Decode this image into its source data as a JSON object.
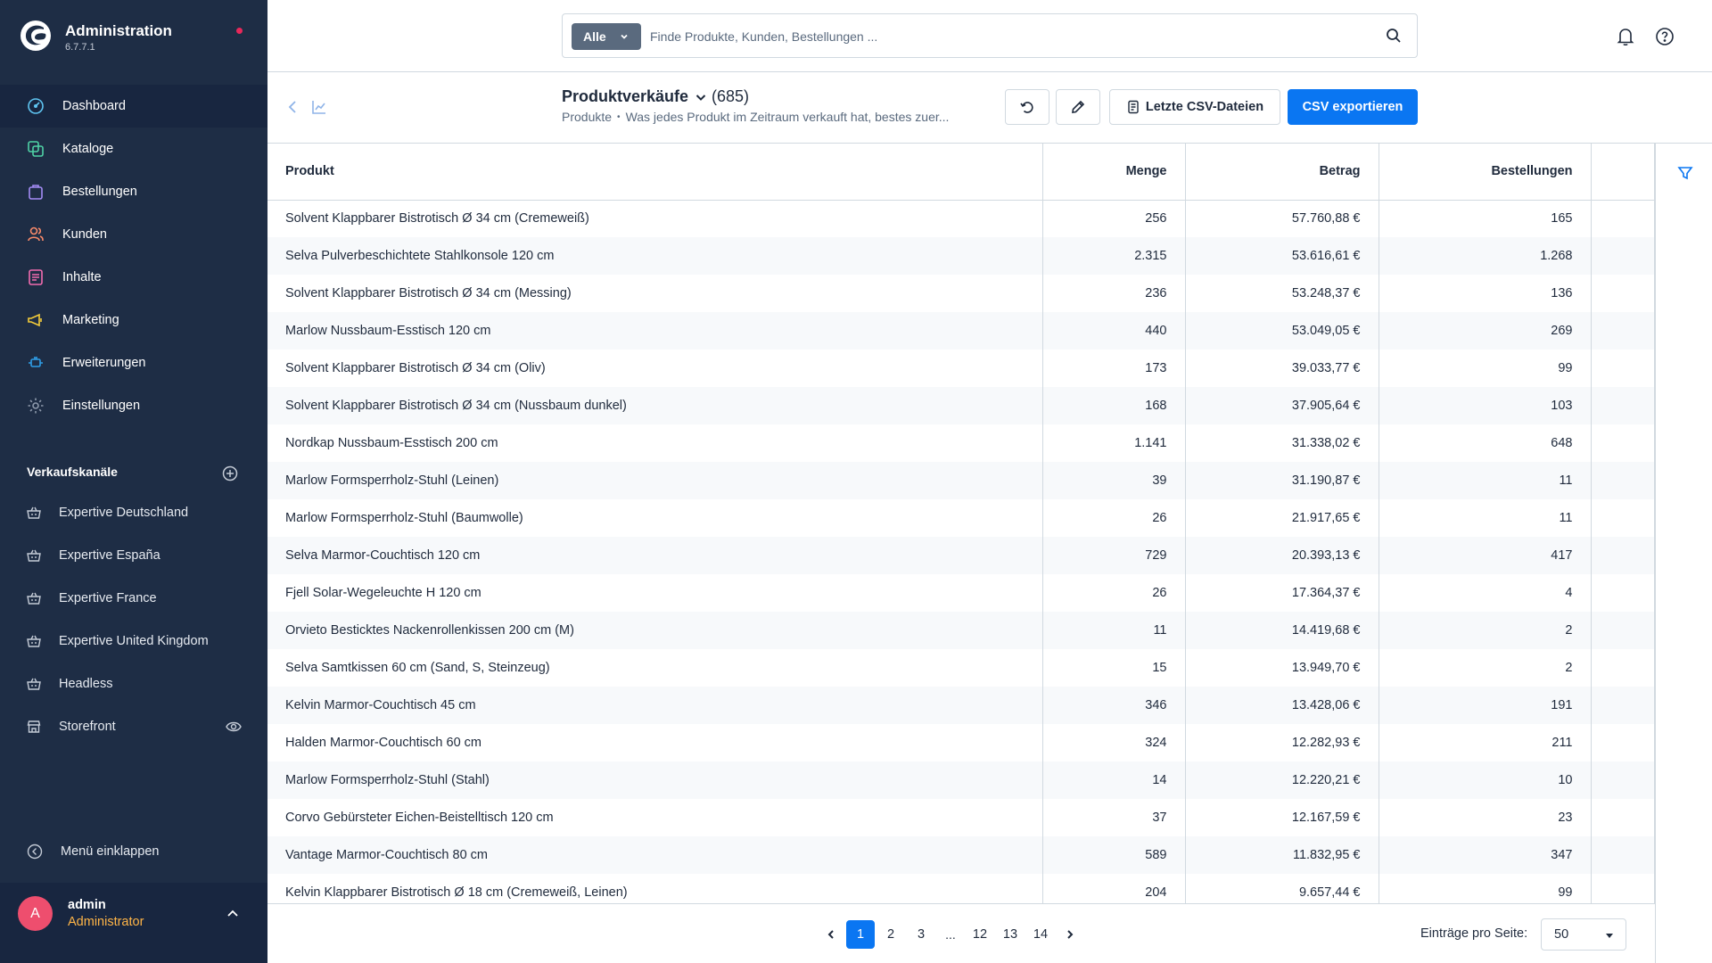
{
  "app": {
    "title": "Administration",
    "version": "6.7.7.1"
  },
  "nav": [
    {
      "label": "Dashboard",
      "icon": "dashboard-icon",
      "active": true
    },
    {
      "label": "Kataloge",
      "icon": "catalog-icon"
    },
    {
      "label": "Bestellungen",
      "icon": "orders-icon"
    },
    {
      "label": "Kunden",
      "icon": "customers-icon"
    },
    {
      "label": "Inhalte",
      "icon": "content-icon"
    },
    {
      "label": "Marketing",
      "icon": "marketing-icon"
    },
    {
      "label": "Erweiterungen",
      "icon": "extensions-icon"
    },
    {
      "label": "Einstellungen",
      "icon": "settings-icon"
    }
  ],
  "sales_channels": {
    "title": "Verkaufskanäle",
    "items": [
      {
        "label": "Expertive Deutschland"
      },
      {
        "label": "Expertive España"
      },
      {
        "label": "Expertive France"
      },
      {
        "label": "Expertive United Kingdom"
      },
      {
        "label": "Headless"
      },
      {
        "label": "Storefront"
      }
    ]
  },
  "collapse_label": "Menü einklappen",
  "user": {
    "initial": "A",
    "name": "admin",
    "role": "Administrator"
  },
  "search": {
    "type": "Alle",
    "placeholder": "Finde Produkte, Kunden, Bestellungen ..."
  },
  "smartbar": {
    "title": "Produktverkäufe",
    "count": "(685)",
    "breadcrumb_root": "Produkte",
    "breadcrumb_desc": "Was jedes Produkt im Zeitraum verkauft hat, bestes zuer...",
    "csv_files_label": "Letzte CSV-Dateien",
    "export_label": "CSV exportieren"
  },
  "colors": {
    "accent": "#0a76f2",
    "sidebar": "#1e2d45",
    "status_dot": "#e8285a",
    "role": "#ffb547"
  },
  "table": {
    "headers": {
      "product": "Produkt",
      "quantity": "Menge",
      "amount": "Betrag",
      "orders": "Bestellungen"
    },
    "rows": [
      {
        "product": "Solvent Klappbarer Bistrotisch Ø 34 cm (Cremeweiß)",
        "quantity": "256",
        "amount": "57.760,88 €",
        "orders": "165"
      },
      {
        "product": "Selva Pulverbeschichtete Stahlkonsole 120 cm",
        "quantity": "2.315",
        "amount": "53.616,61 €",
        "orders": "1.268"
      },
      {
        "product": "Solvent Klappbarer Bistrotisch Ø 34 cm (Messing)",
        "quantity": "236",
        "amount": "53.248,37 €",
        "orders": "136"
      },
      {
        "product": "Marlow Nussbaum-Esstisch 120 cm",
        "quantity": "440",
        "amount": "53.049,05 €",
        "orders": "269"
      },
      {
        "product": "Solvent Klappbarer Bistrotisch Ø 34 cm (Oliv)",
        "quantity": "173",
        "amount": "39.033,77 €",
        "orders": "99"
      },
      {
        "product": "Solvent Klappbarer Bistrotisch Ø 34 cm (Nussbaum dunkel)",
        "quantity": "168",
        "amount": "37.905,64 €",
        "orders": "103"
      },
      {
        "product": "Nordkap Nussbaum-Esstisch 200 cm",
        "quantity": "1.141",
        "amount": "31.338,02 €",
        "orders": "648"
      },
      {
        "product": "Marlow Formsperrholz-Stuhl (Leinen)",
        "quantity": "39",
        "amount": "31.190,87 €",
        "orders": "11"
      },
      {
        "product": "Marlow Formsperrholz-Stuhl (Baumwolle)",
        "quantity": "26",
        "amount": "21.917,65 €",
        "orders": "11"
      },
      {
        "product": "Selva Marmor-Couchtisch 120 cm",
        "quantity": "729",
        "amount": "20.393,13 €",
        "orders": "417"
      },
      {
        "product": "Fjell Solar-Wegeleuchte H 120 cm",
        "quantity": "26",
        "amount": "17.364,37 €",
        "orders": "4"
      },
      {
        "product": "Orvieto Besticktes Nackenrollenkissen 200 cm (M)",
        "quantity": "11",
        "amount": "14.419,68 €",
        "orders": "2"
      },
      {
        "product": "Selva Samtkissen 60 cm (Sand, S, Steinzeug)",
        "quantity": "15",
        "amount": "13.949,70 €",
        "orders": "2"
      },
      {
        "product": "Kelvin Marmor-Couchtisch 45 cm",
        "quantity": "346",
        "amount": "13.428,06 €",
        "orders": "191"
      },
      {
        "product": "Halden Marmor-Couchtisch 60 cm",
        "quantity": "324",
        "amount": "12.282,93 €",
        "orders": "211"
      },
      {
        "product": "Marlow Formsperrholz-Stuhl (Stahl)",
        "quantity": "14",
        "amount": "12.220,21 €",
        "orders": "10"
      },
      {
        "product": "Corvo Gebürsteter Eichen-Beistelltisch 120 cm",
        "quantity": "37",
        "amount": "12.167,59 €",
        "orders": "23"
      },
      {
        "product": "Vantage Marmor-Couchtisch 80 cm",
        "quantity": "589",
        "amount": "11.832,95 €",
        "orders": "347"
      },
      {
        "product": "Kelvin Klappbarer Bistrotisch Ø 18 cm (Cremeweiß, Leinen)",
        "quantity": "204",
        "amount": "9.657,44 €",
        "orders": "99"
      }
    ]
  },
  "pagination": {
    "pages": [
      "1",
      "2",
      "3",
      "...",
      "12",
      "13",
      "14"
    ],
    "current": "1",
    "per_page_label": "Einträge pro Seite:",
    "per_page": "50"
  }
}
